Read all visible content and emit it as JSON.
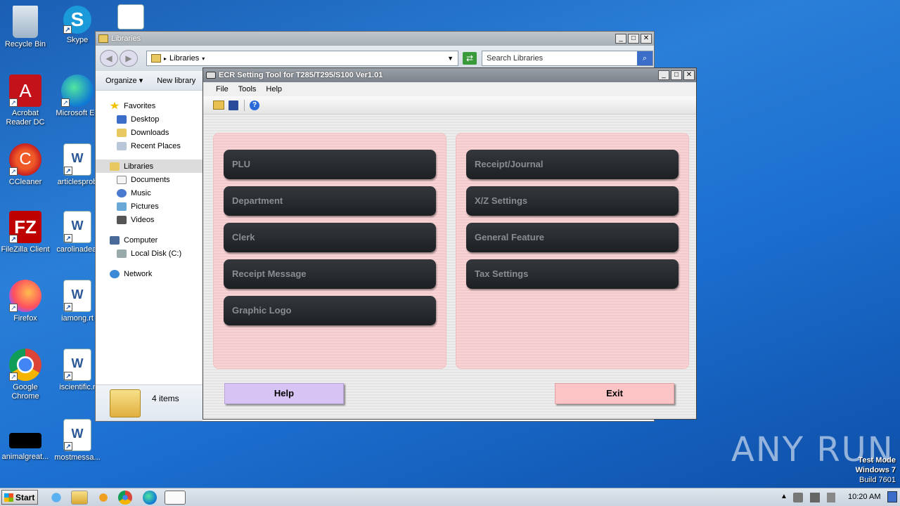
{
  "desktop": {
    "icons": [
      {
        "label": "Recycle Bin",
        "name": "recycle-bin"
      },
      {
        "label": "Skype",
        "name": "skype"
      },
      {
        "label": "Acrobat Reader DC",
        "name": "acrobat"
      },
      {
        "label": "Microsoft Ed",
        "name": "edge"
      },
      {
        "label": "CCleaner",
        "name": "ccleaner"
      },
      {
        "label": "articlesprob",
        "name": "articlesprob"
      },
      {
        "label": "FileZilla Client",
        "name": "filezilla"
      },
      {
        "label": "carolinadeal",
        "name": "carolinadeal"
      },
      {
        "label": "Firefox",
        "name": "firefox"
      },
      {
        "label": "iamong.rt",
        "name": "iamong"
      },
      {
        "label": "Google Chrome",
        "name": "chrome"
      },
      {
        "label": "iscientific.r",
        "name": "iscientific"
      },
      {
        "label": "animalgreat...",
        "name": "animalgreat"
      },
      {
        "label": "mostmessa...",
        "name": "mostmessa"
      }
    ],
    "watermark": {
      "brand": "ANY RUN",
      "line1": "Test Mode",
      "line2": "Windows 7",
      "line3": "Build 7601"
    }
  },
  "explorer": {
    "title": "Libraries",
    "address": "Libraries",
    "search_placeholder": "Search Libraries",
    "toolbar": {
      "organize": "Organize",
      "new_library": "New library"
    },
    "nav": {
      "favorites": "Favorites",
      "desktop": "Desktop",
      "downloads": "Downloads",
      "recent": "Recent Places",
      "libraries": "Libraries",
      "documents": "Documents",
      "music": "Music",
      "pictures": "Pictures",
      "videos": "Videos",
      "computer": "Computer",
      "local_disk": "Local Disk (C:)",
      "network": "Network"
    },
    "status": "4 items"
  },
  "ecr": {
    "title": "ECR Setting Tool for T285/T295/S100 Ver1.01",
    "menu": {
      "file": "File",
      "tools": "Tools",
      "help": "Help"
    },
    "left_buttons": [
      "PLU",
      "Department",
      "Clerk",
      "Receipt Message",
      "Graphic Logo"
    ],
    "right_buttons": [
      "Receipt/Journal",
      "X/Z Settings",
      "General Feature",
      "Tax Settings"
    ],
    "help_button": "Help",
    "exit_button": "Exit"
  },
  "taskbar": {
    "start": "Start",
    "clock": "10:20 AM"
  }
}
